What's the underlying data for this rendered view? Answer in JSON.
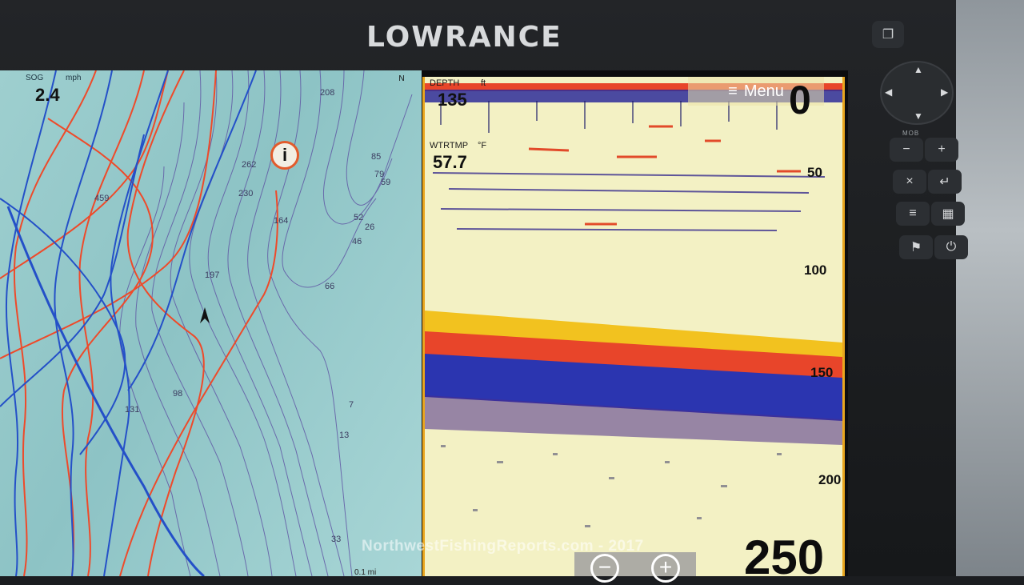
{
  "device": {
    "brand": "LOWRANCE"
  },
  "chart_pane": {
    "sog_label": "SOG",
    "sog_unit": "mph",
    "sog_value": "2.4",
    "north_indicator": "N",
    "scale_label": "0.1 mi",
    "info_symbol": "i",
    "depth_labels": [
      "208",
      "262",
      "230",
      "459",
      "164",
      "197",
      "85",
      "79",
      "59",
      "52",
      "26",
      "46",
      "66",
      "98",
      "131",
      "7",
      "13",
      "33"
    ]
  },
  "sonar_pane": {
    "depth_label": "DEPTH",
    "depth_unit": "ft",
    "depth_value": "135",
    "temp_label": "WTRTMP",
    "temp_unit": "°F",
    "temp_value": "57.7",
    "menu_label": "Menu",
    "range_top": "0",
    "range_bottom": "250",
    "ticks": [
      "50",
      "100",
      "150",
      "200"
    ],
    "zoom_out": "−",
    "zoom_in": "+"
  },
  "hardware_keys": {
    "mob_label": "MOB",
    "minus": "−",
    "plus": "+",
    "cancel": "×",
    "enter": "↵",
    "menu": "≡",
    "pages": "▦",
    "waypoint": "⚑",
    "power": "⏻",
    "pages_top": "❐"
  },
  "watermark": "NorthwestFishingReports.com - 2017"
}
